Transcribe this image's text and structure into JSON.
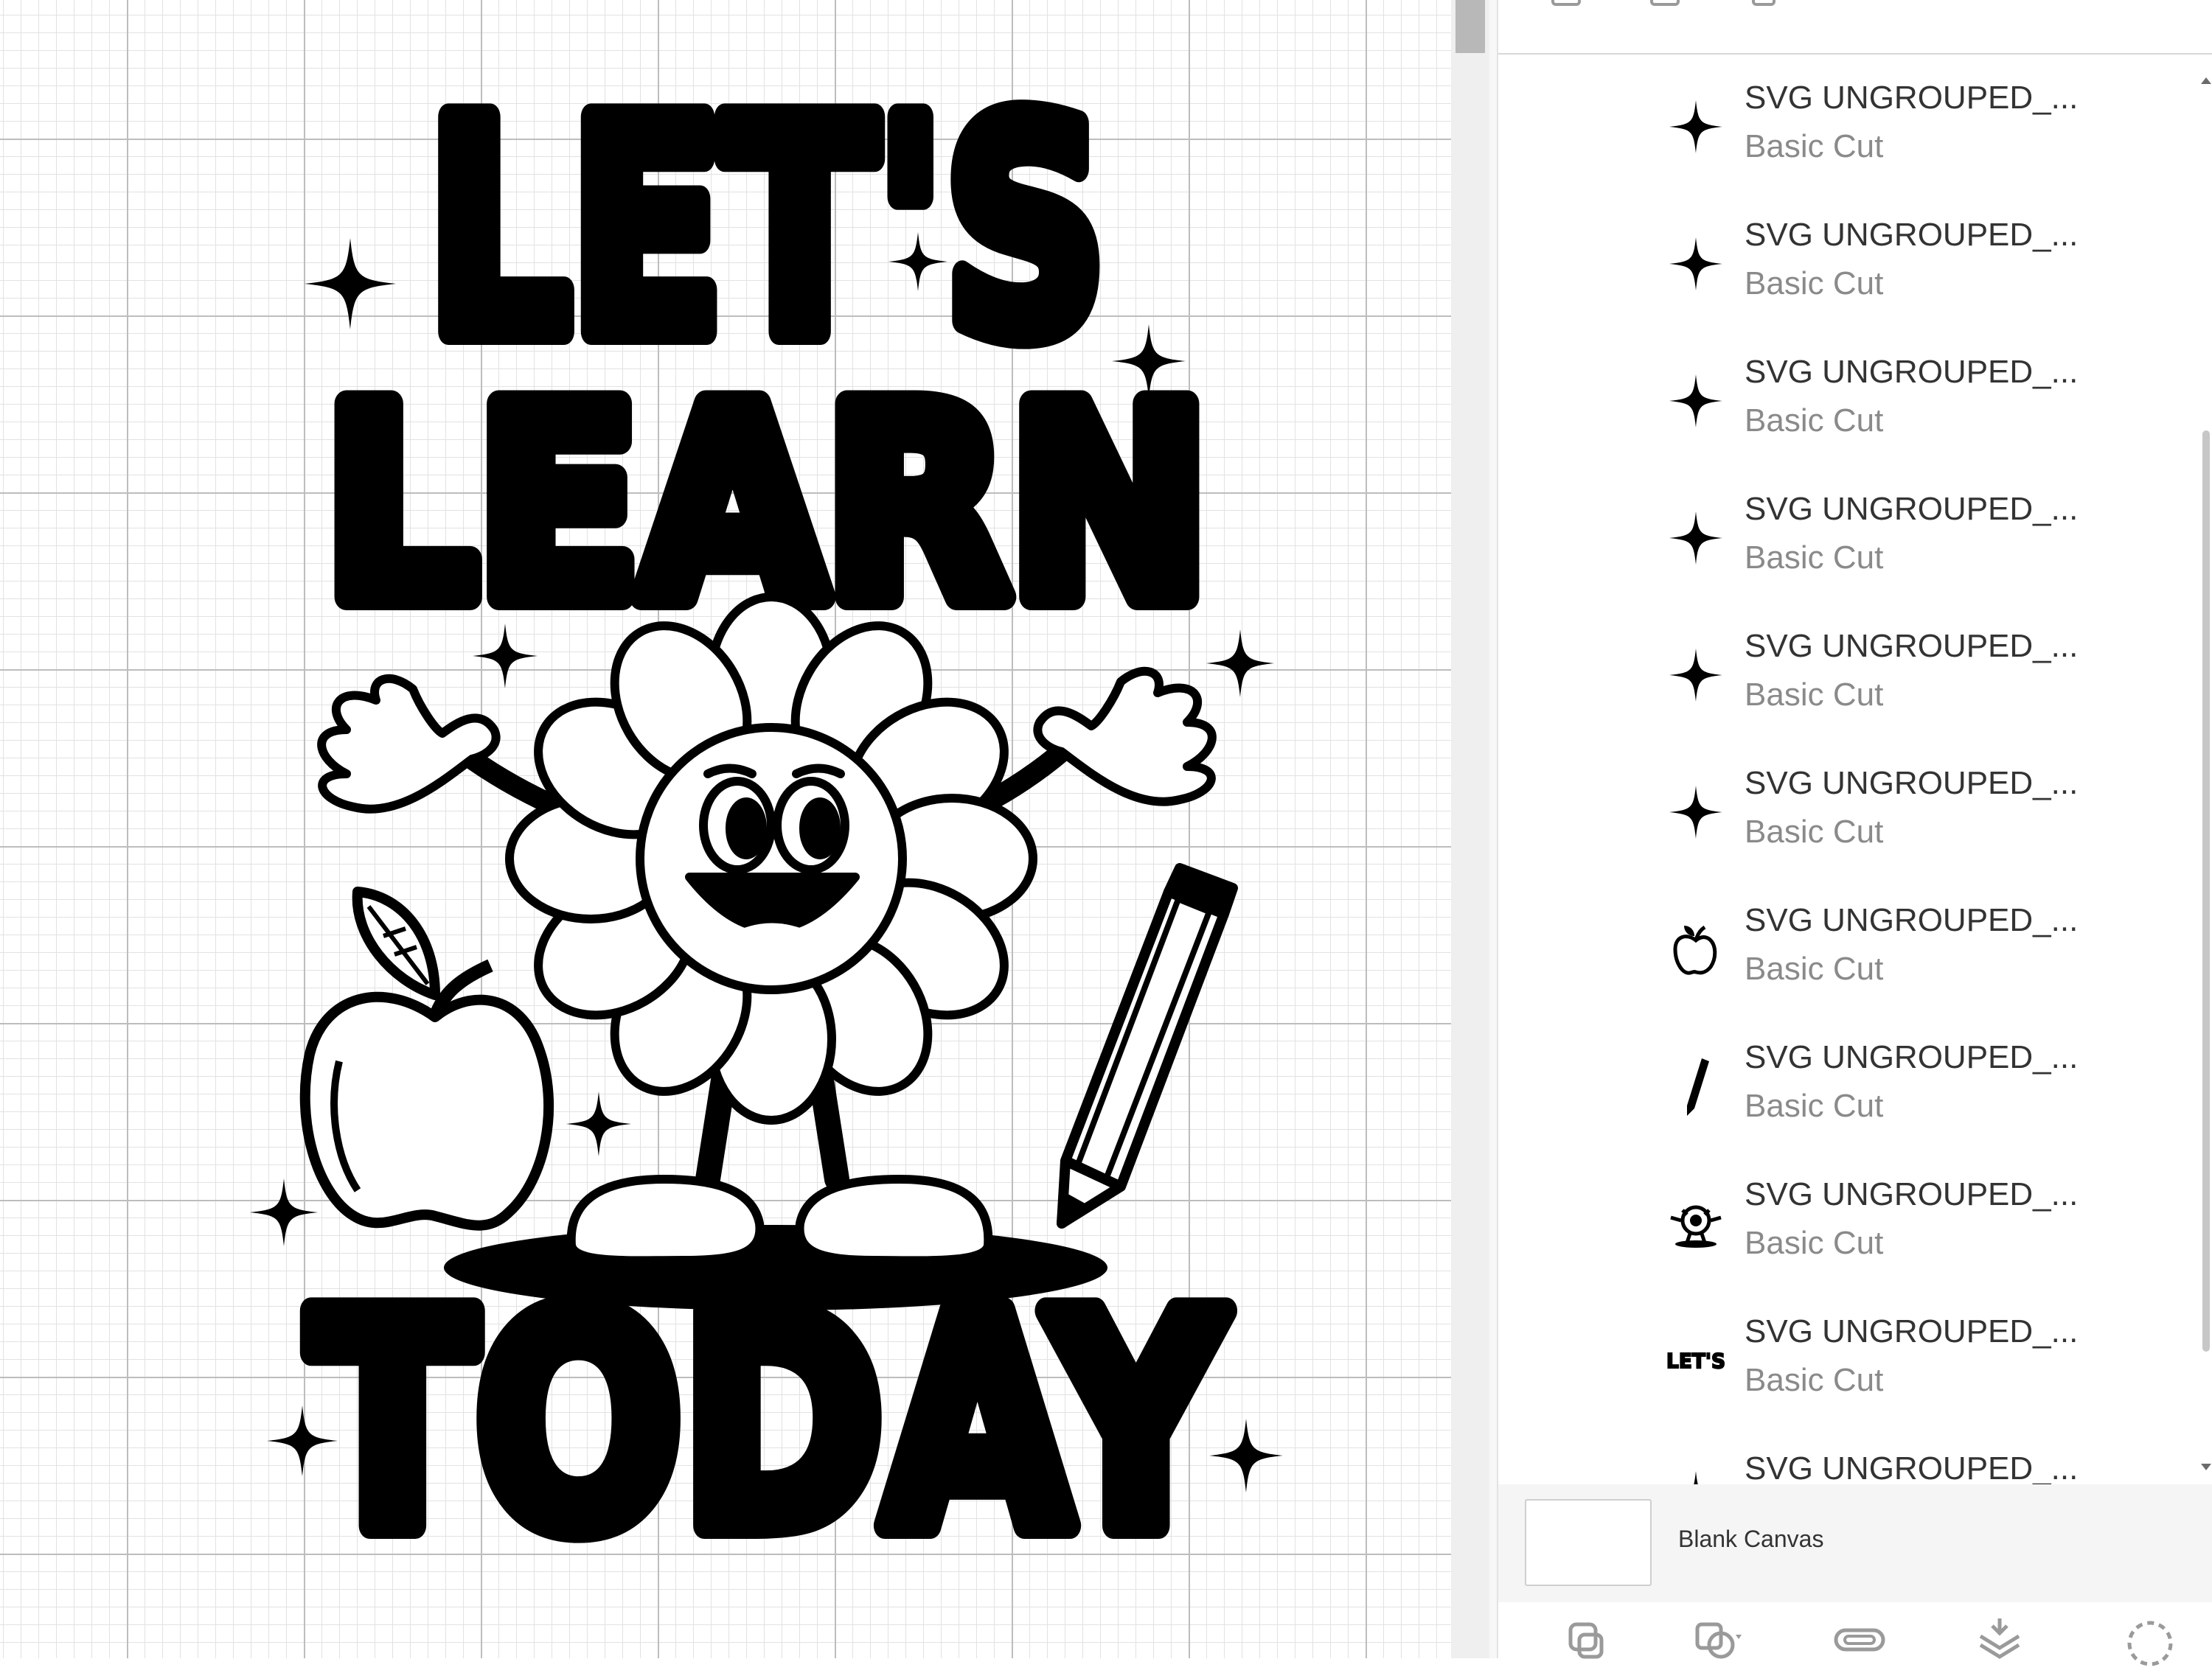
{
  "canvas": {
    "art_words": [
      "LET'S",
      "LEARN",
      "TODAY"
    ]
  },
  "layers": {
    "items": [
      {
        "name": "SVG UNGROUPED_...",
        "operation": "Basic Cut",
        "thumb": "sparkle-icon"
      },
      {
        "name": "SVG UNGROUPED_...",
        "operation": "Basic Cut",
        "thumb": "sparkle-icon"
      },
      {
        "name": "SVG UNGROUPED_...",
        "operation": "Basic Cut",
        "thumb": "sparkle-icon"
      },
      {
        "name": "SVG UNGROUPED_...",
        "operation": "Basic Cut",
        "thumb": "sparkle-icon"
      },
      {
        "name": "SVG UNGROUPED_...",
        "operation": "Basic Cut",
        "thumb": "sparkle-icon"
      },
      {
        "name": "SVG UNGROUPED_...",
        "operation": "Basic Cut",
        "thumb": "sparkle-icon"
      },
      {
        "name": "SVG UNGROUPED_...",
        "operation": "Basic Cut",
        "thumb": "apple-icon"
      },
      {
        "name": "SVG UNGROUPED_...",
        "operation": "Basic Cut",
        "thumb": "pencil-icon"
      },
      {
        "name": "SVG UNGROUPED_...",
        "operation": "Basic Cut",
        "thumb": "flower-icon"
      },
      {
        "name": "SVG UNGROUPED_...",
        "operation": "Basic Cut",
        "thumb": "lets-text-icon",
        "thumb_text": "LET'S"
      },
      {
        "name": "SVG UNGROUPED_...",
        "operation": "",
        "thumb": "sparkle-icon"
      }
    ]
  },
  "blank_canvas": {
    "label": "Blank Canvas"
  },
  "toolbar_icons": [
    "group-icon",
    "combine-icon",
    "attach-icon",
    "flatten-icon",
    "contour-icon"
  ],
  "colors": {
    "art": "#000000",
    "panel_text": "#333333",
    "subtext": "#8a8a8a"
  }
}
